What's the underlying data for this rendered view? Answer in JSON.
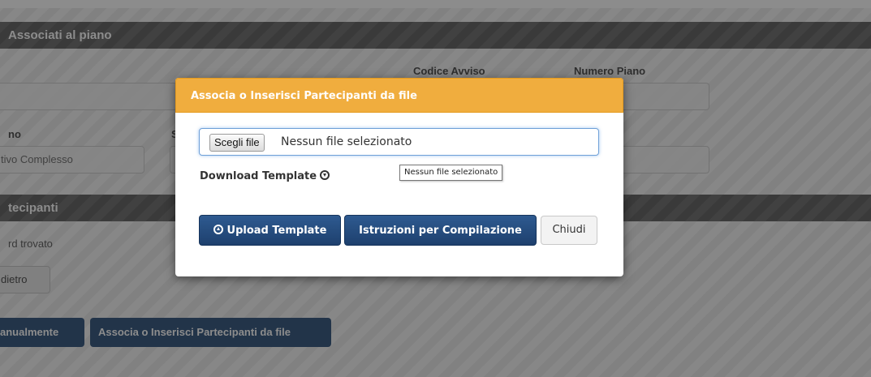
{
  "background": {
    "section1_title": "Associati al piano",
    "labels": {
      "codice_avviso": "Codice Avviso",
      "numero_piano": "Numero Piano",
      "partial_left": "no",
      "partial_mid": "S"
    },
    "field_value": "tivo Complesso",
    "section2_title": "tecipanti",
    "record_text": "rd trovato",
    "back_button": "dietro",
    "btn_manual": "anualmente",
    "btn_file": "Associa o Inserisci Partecipanti da file"
  },
  "modal": {
    "title": "Associa o Inserisci Partecipanti da file",
    "choose_file_label": "Scegli file",
    "no_file_text": "Nessun file selezionato",
    "tooltip": "Nessun file selezionato",
    "download_template_label": "Download Template",
    "upload_template_label": "Upload Template",
    "istruzioni_label": "Istruzioni per Compilazione",
    "chiudi_label": "Chiudi"
  },
  "colors": {
    "modal_header": "#f0ad3e",
    "primary_button": "#1e406e",
    "overlay": "rgba(0,0,0,0.45)"
  }
}
